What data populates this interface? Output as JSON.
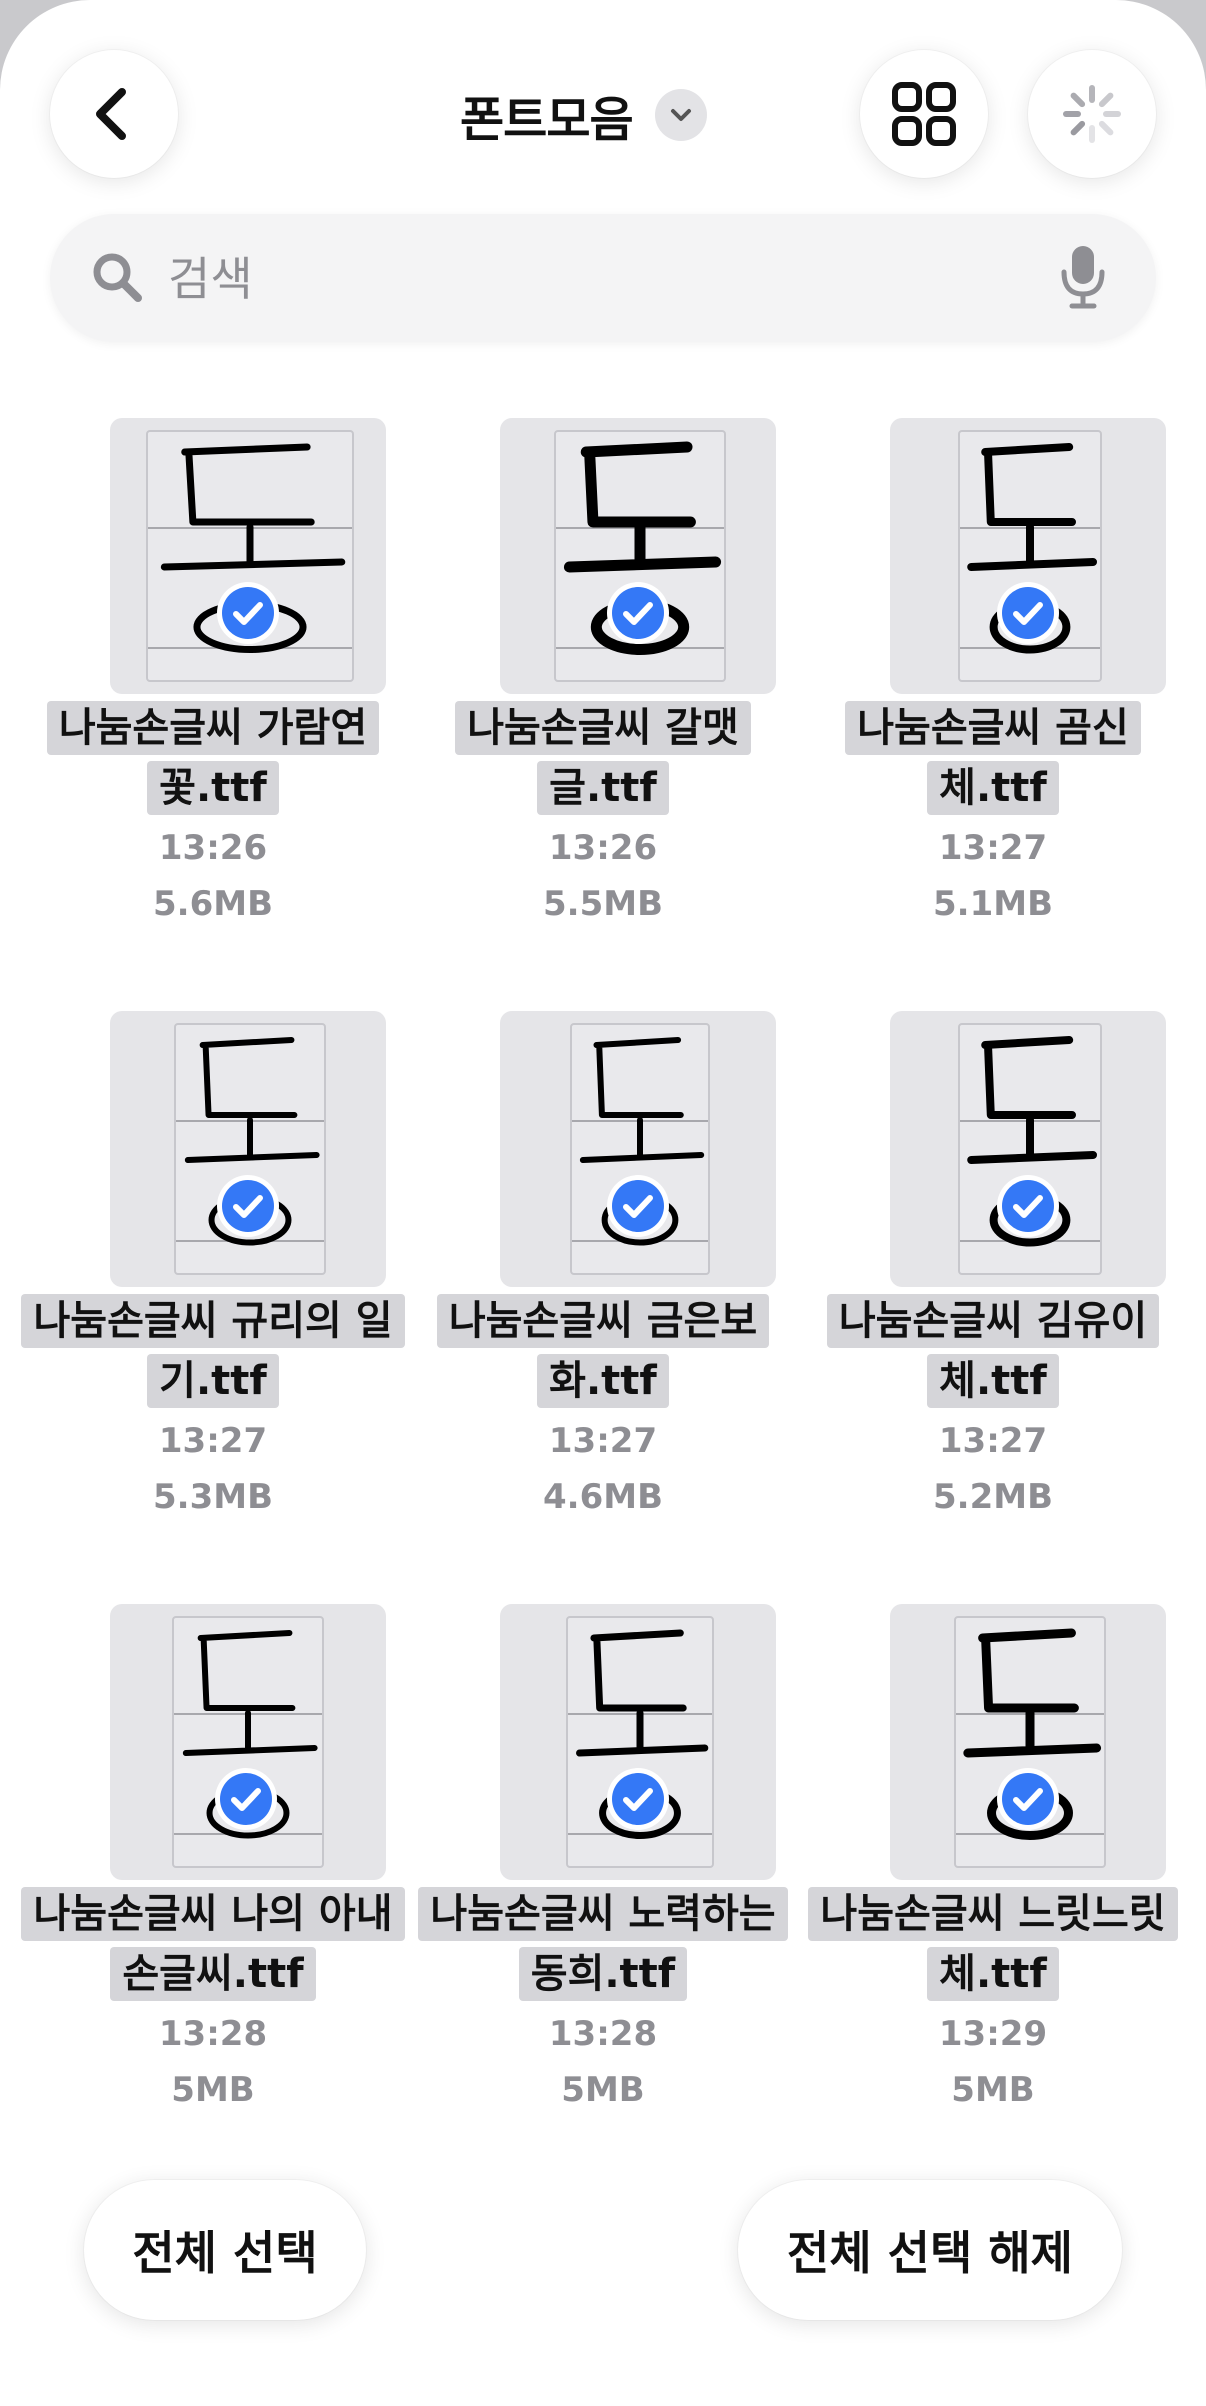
{
  "header": {
    "title": "폰트모음",
    "back_icon": "chevron-left-icon",
    "title_menu_icon": "chevron-down-icon",
    "grid_view_icon": "grid-icon",
    "loading_icon": "spinner-icon"
  },
  "search": {
    "placeholder": "검색",
    "value": ""
  },
  "files": [
    {
      "name": "나눔손글씨 가람연꽃.ttf",
      "time": "13:26",
      "size": "5.6MB",
      "selected": true
    },
    {
      "name": "나눔손글씨 갈맷글.ttf",
      "time": "13:26",
      "size": "5.5MB",
      "selected": true
    },
    {
      "name": "나눔손글씨 곰신체.ttf",
      "time": "13:27",
      "size": "5.1MB",
      "selected": true
    },
    {
      "name": "나눔손글씨 규리의 일기.ttf",
      "time": "13:27",
      "size": "5.3MB",
      "selected": true
    },
    {
      "name": "나눔손글씨 금은보화.ttf",
      "time": "13:27",
      "size": "4.6MB",
      "selected": true
    },
    {
      "name": "나눔손글씨 김유이체.ttf",
      "time": "13:27",
      "size": "5.2MB",
      "selected": true
    },
    {
      "name": "나눔손글씨 나의 아내 손글씨.ttf",
      "time": "13:28",
      "size": "5MB",
      "selected": true
    },
    {
      "name": "나눔손글씨 노력하는 동희.ttf",
      "time": "13:28",
      "size": "5MB",
      "selected": true
    },
    {
      "name": "나눔손글씨 느릿느릿체.ttf",
      "time": "13:29",
      "size": "5MB",
      "selected": true
    }
  ],
  "footer": {
    "select_all": "전체 선택",
    "deselect_all": "전체 선택 해제"
  },
  "colors": {
    "accent": "#3478f6",
    "selection_highlight": "#d5d5d9",
    "secondary_text": "#8e8e93"
  }
}
